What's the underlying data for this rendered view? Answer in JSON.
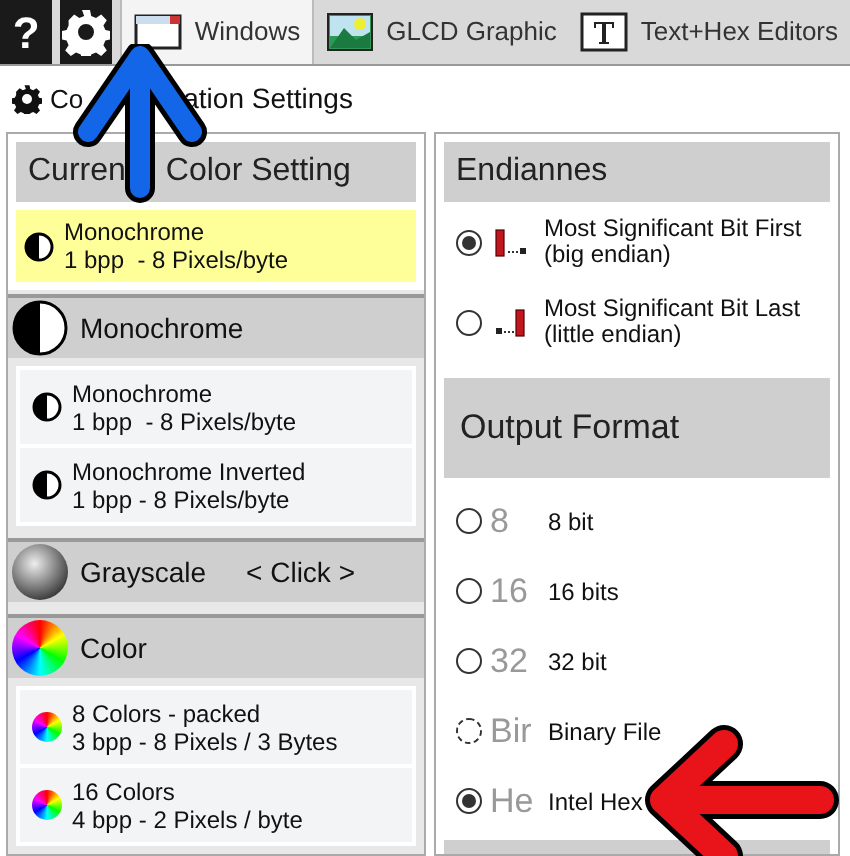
{
  "toolbar": [
    {
      "kind": "help",
      "label": "?"
    },
    {
      "kind": "settings"
    }
  ],
  "tabs": [
    {
      "label": "Windows",
      "kind": "window",
      "selected": true
    },
    {
      "label": "GLCD Graphic",
      "kind": "image",
      "selected": false
    },
    {
      "label": "Text+Hex Editors",
      "kind": "text",
      "selected": false
    }
  ],
  "section_title": {
    "parts": [
      "Co",
      "ation Settings"
    ]
  },
  "current": {
    "header_parts": [
      "Curren",
      "Color Setting"
    ],
    "item": {
      "kind": "mono",
      "lines": [
        "Monochrome",
        "1 bpp  - 8 Pixels/byte"
      ]
    }
  },
  "groups": [
    {
      "title": "Monochrome",
      "kind": "mono",
      "items": [
        {
          "kind": "mono",
          "lines": [
            "Monochrome",
            "1 bpp  - 8 Pixels/byte"
          ]
        },
        {
          "kind": "mono",
          "lines": [
            "Monochrome Inverted",
            "1 bpp - 8 Pixels/byte"
          ]
        }
      ]
    },
    {
      "title": "Grayscale",
      "hint": "< Click >",
      "kind": "gray"
    },
    {
      "title": "Color",
      "kind": "color",
      "items": [
        {
          "kind": "color",
          "lines": [
            "8 Colors - packed",
            "3 bpp - 8 Pixels / 3 Bytes"
          ]
        },
        {
          "kind": "color",
          "lines": [
            "16 Colors",
            "4 bpp - 2 Pixels / byte"
          ]
        }
      ]
    }
  ],
  "endianness": {
    "title": "Endiannes",
    "options": [
      {
        "kind": "msb",
        "lines": [
          "Most Significant Bit First",
          "(big endian)"
        ],
        "selected": true
      },
      {
        "kind": "lsb",
        "lines": [
          "Most Significant Bit Last",
          "(little endian)"
        ],
        "selected": false
      }
    ]
  },
  "output_format": {
    "title": "Output Format",
    "options": [
      {
        "glyph": "8",
        "label": "8 bit",
        "selected": false
      },
      {
        "glyph": "16",
        "label": "16 bits",
        "selected": false
      },
      {
        "glyph": "32",
        "label": "32 bit",
        "selected": false
      },
      {
        "glyph": "Bir",
        "label": "Binary File",
        "selected": false,
        "focused": true
      },
      {
        "glyph": "He",
        "label": "Intel Hex",
        "selected": true
      }
    ]
  },
  "annotations": [
    {
      "kind": "up"
    },
    {
      "kind": "left"
    }
  ]
}
